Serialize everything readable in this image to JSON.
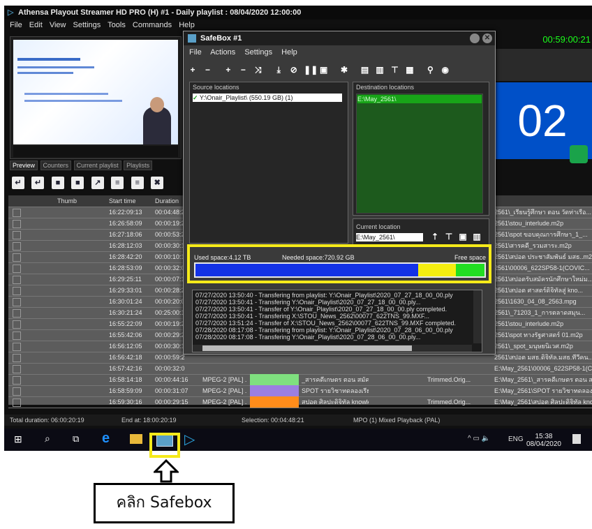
{
  "app": {
    "title": "Athensa Playout Streamer HD PRO (H) #1 - Daily playlist : 08/04/2020 12:00:00",
    "menu": [
      "File",
      "Edit",
      "View",
      "Settings",
      "Tools",
      "Commands",
      "Help"
    ],
    "countdown": "00:59:00:21",
    "big_digits": "02"
  },
  "left_tabs": [
    "Preview",
    "Counters",
    "Current playlist",
    "Playlists"
  ],
  "playlist": {
    "headers": [
      "",
      "Thumb",
      "Start time",
      "Duration"
    ],
    "rows": [
      {
        "start": "16:22:09:13",
        "duration": "00:04:48:2",
        "right": "2561\\_เรียนรู้ศึกษา ตอน วัดท่าเรือ..."
      },
      {
        "start": "16:26:58:09",
        "duration": "00:00:19:2",
        "right": "2561\\stou_interlude.m2p"
      },
      {
        "start": "16:27:18:06",
        "duration": "00:00:53:2",
        "right": "2561\\spot ขอบคุณการศึกษา_1_..."
      },
      {
        "start": "16:28:12:03",
        "duration": "00:00:30:1",
        "right": "2561\\สารคดี_รวมสาระ.m2p"
      },
      {
        "start": "16:28:42:20",
        "duration": "00:00:10:1",
        "right": "2561\\สปอต ประชาสัมพันธ์ มสธ..m2p"
      },
      {
        "start": "16:28:53:09",
        "duration": "00:00:32:0",
        "right": "2561\\00006_622SP58-1(COVIC..."
      },
      {
        "start": "16:29:25:11",
        "duration": "00:00:07:1",
        "right": "2561\\สปอตรับสมัครนักศึกษาใหม่ม..."
      },
      {
        "start": "16:29:33:01",
        "duration": "00:00:28:2",
        "right": "2561\\สปอต ศาสตร์ดิจิทัลสู่ kno..."
      },
      {
        "start": "16:30:01:24",
        "duration": "00:00:20:0",
        "right": "2561\\1630_04_08_2563.mpg"
      },
      {
        "start": "16:30:21:24",
        "duration": "00:25:00:1",
        "right": "2561\\_71203_1_การตลาดสมุน..."
      },
      {
        "start": "16:55:22:09",
        "duration": "00:00:19:2",
        "right": "2561\\stou_interlude.m2p"
      },
      {
        "start": "16:55:42:06",
        "duration": "00:00:29:2",
        "right": "2561\\spot ทางรัฐศาสตร์ 01.m2p"
      },
      {
        "start": "16:56:12:05",
        "duration": "00:00:30:1",
        "right": "2561\\_spot_มนุษยนิเวศ.m2p"
      },
      {
        "start": "16:56:42:18",
        "duration": "00:00:59:2",
        "right": "2561\\สปอต มสธ.ดิจิทัล.มสธ.ทีวีคน..."
      },
      {
        "start": "16:57:42:16",
        "duration": "00:00:32:0",
        "right": "E:\\May_2561\\00006_622SP58-1(COVIC..."
      },
      {
        "start": "16:58:14:18",
        "duration": "00:00:44:16",
        "format": "MPEG-2 [PAL] ...",
        "title": "_สารคดีเกษตร ตอน สมัครเรียน...",
        "type": "Trimmed.Orig...",
        "right": "E:\\May_2561\\_สารคดีเกษตร ตอน สมัครเรียน..."
      },
      {
        "start": "16:58:59:09",
        "duration": "00:00:31:07",
        "format": "MPEG-2 [PAL] ...",
        "title": "SPOT รายวิชาทดลองเรียน",
        "type": "",
        "right": "E:\\May_2561\\SPOT รายวิชาทดลองเรียน.mpg"
      },
      {
        "start": "16:59:30:16",
        "duration": "00:00:29:15",
        "format": "MPEG-2 [PAL] ...",
        "title": "สปอต ศิลปะดิจิทัล knowled...",
        "type": "Trimmed.Orig...",
        "right": "E:\\May_2561\\สปอต ศิลปะดิจิทัล knowle..."
      }
    ]
  },
  "status_bar": {
    "total_duration": "Total duration: 06:00:20:19",
    "end_at": "End at: 18:00:20:19",
    "selection": "Selection: 00:04:48:21",
    "mode": "MPO (1) Mixed Playback (PAL)"
  },
  "safebox": {
    "title": "SafeBox #1",
    "menu": [
      "File",
      "Actions",
      "Settings",
      "Help"
    ],
    "source_label": "Source locations",
    "source_item": "Y:\\Onair_Playlist\\ (550.19 GB) (1)",
    "destination_label": "Destination locations",
    "destination_item": "E:\\May_2561\\",
    "current_location_label": "Current location",
    "current_location_value": "E:\\May_2561\\",
    "storage": {
      "used_label": "Used space:4.12 TB",
      "needed_label": "Needed space:720.92 GB",
      "free_label": "Free space",
      "used_fraction": 0.77,
      "needed_fraction": 0.13,
      "free_fraction": 0.1,
      "colors": {
        "used": "#1432e6",
        "needed": "#f5ee10",
        "free": "#22dd22"
      }
    },
    "log": [
      "07/27/2020 13:50:40 - Transfering from playlist: Y:\\Onair_Playlist\\2020_07_27_18_00_00.ply",
      "07/27/2020 13:50:41 - Transfering Y:\\Onair_Playlist\\2020_07_27_18_00_00.ply...",
      "07/27/2020 13:50:41 - Transfer of Y:\\Onair_Playlist\\2020_07_27_18_00_00.ply completed.",
      "07/27/2020 13:50:41 - Transfering X:\\STOU_News_2562\\00077_622TNS_99.MXF...",
      "07/27/2020 13:51:24 - Transfer of X:\\STOU_News_2562\\00077_622TNS_99.MXF completed.",
      "07/28/2020 08:17:08 - Transfering from playlist: Y:\\Onair_Playlist\\2020_07_28_06_00_00.ply",
      "07/28/2020 08:17:08 - Transfering Y:\\Onair_Playlist\\2020_07_28_06_00_00.ply..."
    ]
  },
  "taskbar": {
    "lang": "ENG",
    "time": "15:38",
    "date": "08/04/2020"
  },
  "callout": {
    "text": "คลิก Safebox"
  }
}
